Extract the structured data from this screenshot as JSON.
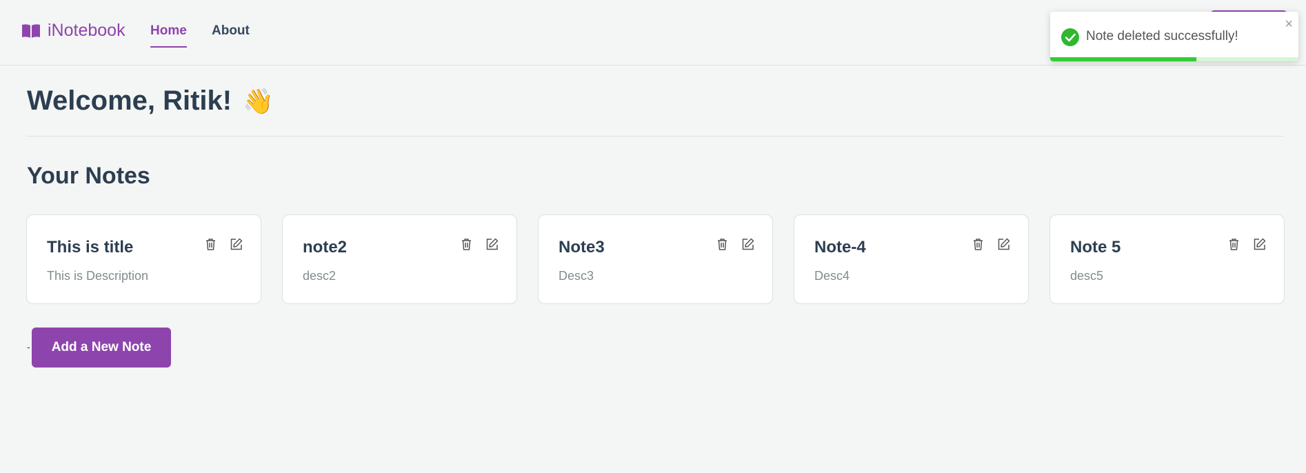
{
  "navbar": {
    "brand": "iNotebook",
    "links": [
      {
        "label": "Home",
        "active": true
      },
      {
        "label": "About",
        "active": false
      }
    ]
  },
  "toast": {
    "message": "Note deleted successfully!",
    "close": "×",
    "progress": 0.59,
    "color": "#33cc33"
  },
  "main": {
    "welcome": "Welcome, Ritik!",
    "wave_emoji": "👋",
    "section_title": "Your Notes",
    "notes": [
      {
        "title": "This is title",
        "description": "This is Description"
      },
      {
        "title": "note2",
        "description": "desc2"
      },
      {
        "title": "Note3",
        "description": "Desc3"
      },
      {
        "title": "Note-4",
        "description": "Desc4"
      },
      {
        "title": "Note 5",
        "description": "desc5"
      }
    ],
    "add_button": "Add a New Note",
    "dash": "-"
  },
  "colors": {
    "accent": "#8e44ad",
    "text": "#2c3e50",
    "muted": "#7f8c8d",
    "background": "#f4f5f5"
  },
  "icons": {
    "brand": "book-open-icon",
    "delete": "trash-icon",
    "edit": "edit-icon",
    "toast": "check-circle-icon"
  }
}
